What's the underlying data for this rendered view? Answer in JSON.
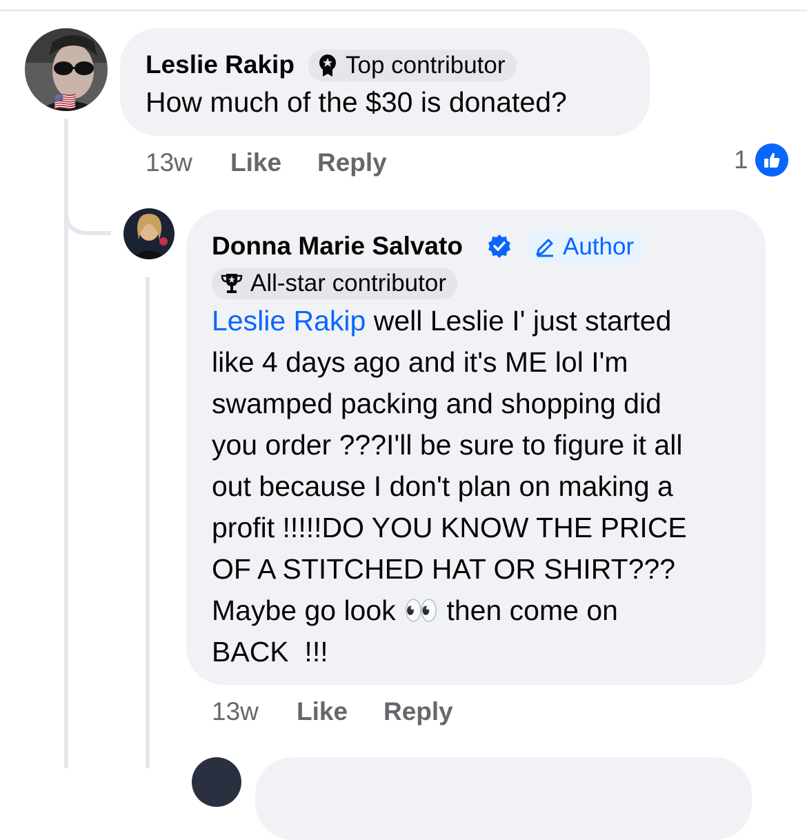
{
  "comments": [
    {
      "author": "Leslie Rakip",
      "badge": "Top contributor",
      "text": "How much of the $30 is donated?",
      "time": "13w",
      "like_label": "Like",
      "reply_label": "Reply",
      "reaction_count": "1",
      "avatar_flag": "🇺🇸"
    },
    {
      "author": "Donna Marie Salvato",
      "author_badge": "Author",
      "badge": "All-star contributor",
      "mention": "Leslie Rakip",
      "text_lines": [
        " well Leslie I' just started",
        "like 4 days ago and it's ME lol I'm",
        "swamped packing and shopping did",
        "you order ???I'll be sure to figure it all",
        "out because I don't plan on making a",
        "profit !!!!!DO YOU KNOW THE PRICE",
        "OF A STITCHED HAT OR SHIRT???",
        "Maybe go look 👀 then come on",
        "BACK  !!!"
      ],
      "time": "13w",
      "like_label": "Like",
      "reply_label": "Reply"
    }
  ],
  "colors": {
    "accent": "#0866ff",
    "bubble": "#f0f2f5",
    "secondary_text": "#65676b"
  },
  "icons": [
    "ribbon-badge-icon",
    "verified-icon",
    "pencil-icon",
    "trophy-icon",
    "thumbs-up-icon"
  ]
}
